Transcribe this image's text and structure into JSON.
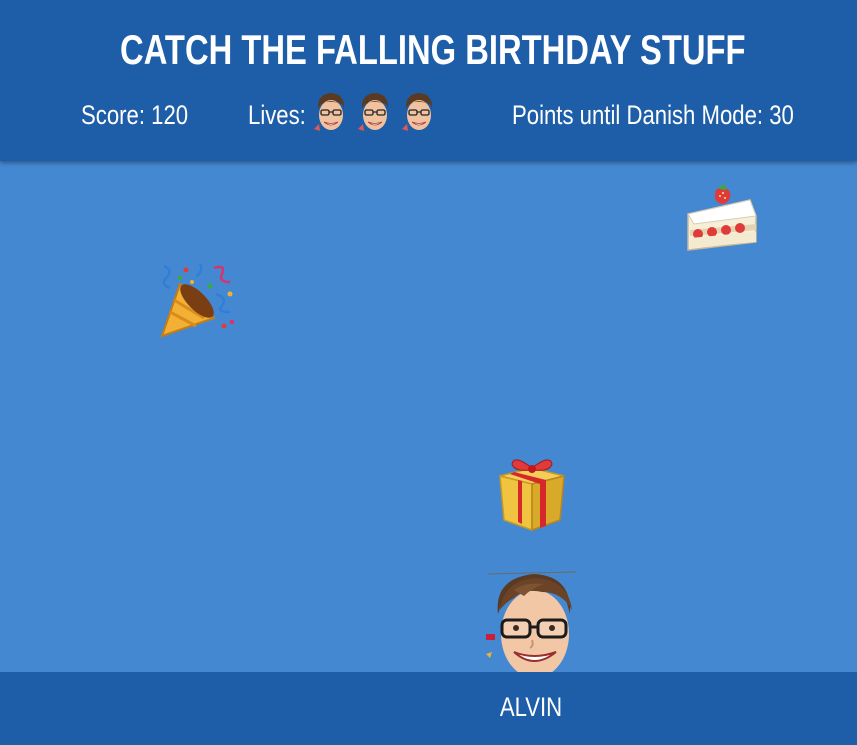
{
  "header": {
    "title": "CATCH THE FALLING BIRTHDAY STUFF",
    "score_label": "Score: 120",
    "lives_label": "Lives:",
    "lives_count": 3,
    "danish_label": "Points until Danish Mode: 30"
  },
  "falling_items": [
    {
      "kind": "party-popper",
      "icon": "party-popper-icon"
    },
    {
      "kind": "cake",
      "icon": "shortcake-icon"
    },
    {
      "kind": "gift",
      "icon": "gift-icon"
    }
  ],
  "player": {
    "name": "ALVIN",
    "icon": "player-face-icon"
  },
  "colors": {
    "background": "#4488d2",
    "bar": "#1e5ea8",
    "text": "#ffffff"
  }
}
